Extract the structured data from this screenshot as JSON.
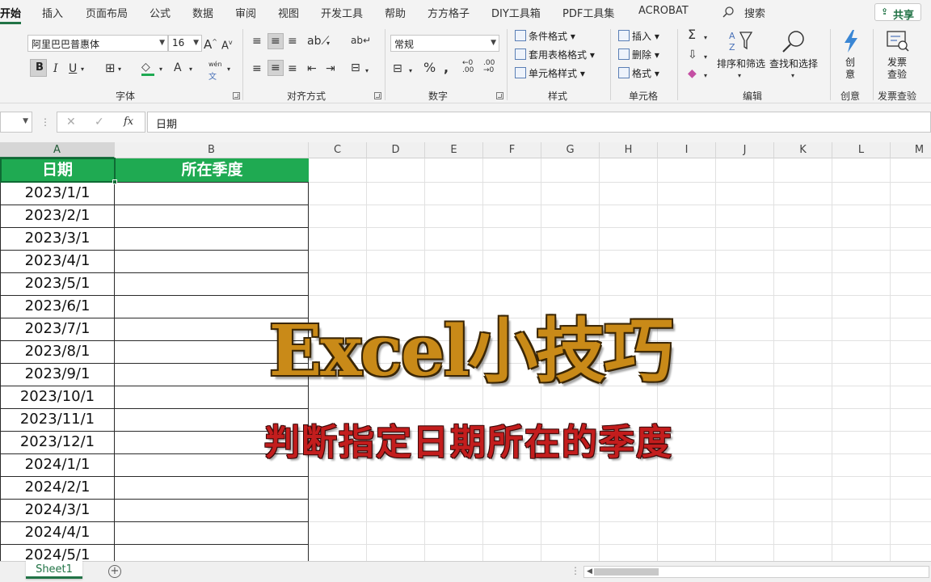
{
  "tabs": [
    {
      "label": "开始",
      "active": true
    },
    {
      "label": "插入"
    },
    {
      "label": "页面布局"
    },
    {
      "label": "公式"
    },
    {
      "label": "数据"
    },
    {
      "label": "审阅"
    },
    {
      "label": "视图"
    },
    {
      "label": "开发工具"
    },
    {
      "label": "帮助"
    },
    {
      "label": "方方格子"
    },
    {
      "label": "DIY工具箱"
    },
    {
      "label": "PDF工具集"
    },
    {
      "label": "ACROBAT"
    }
  ],
  "search_label": "搜索",
  "share_label": "共享",
  "ribbon": {
    "font_name": "阿里巴巴普惠体",
    "font_size": "16",
    "number_format": "常规",
    "font_group": "字体",
    "alignment_group": "对齐方式",
    "number_group": "数字",
    "styles_group": "样式",
    "cells_group": "单元格",
    "editing_group": "编辑",
    "creativity_group": "创意",
    "invoice_group": "发票查验",
    "conditional_format": "条件格式",
    "table_format": "套用表格格式",
    "cell_styles": "单元格样式",
    "insert": "插入",
    "delete": "删除",
    "format": "格式",
    "sort_filter": "排序和筛选",
    "find_select": "查找和选择",
    "create": "创意",
    "invoice_check": "发票查验",
    "phonetic": "wén",
    "phonetic_char": "文"
  },
  "formula_bar": {
    "value": "日期"
  },
  "columns": [
    "A",
    "B",
    "C",
    "D",
    "E",
    "F",
    "G",
    "H",
    "I",
    "J",
    "K",
    "L",
    "M"
  ],
  "headers": {
    "a": "日期",
    "b": "所在季度"
  },
  "dates": [
    "2023/1/1",
    "2023/2/1",
    "2023/3/1",
    "2023/4/1",
    "2023/5/1",
    "2023/6/1",
    "2023/7/1",
    "2023/8/1",
    "2023/9/1",
    "2023/10/1",
    "2023/11/1",
    "2023/12/1",
    "2024/1/1",
    "2024/2/1",
    "2024/3/1",
    "2024/4/1",
    "2024/5/1"
  ],
  "overlay": {
    "title": "Excel小技巧",
    "subtitle": "判断指定日期所在的季度"
  },
  "sheet_tab": "Sheet1",
  "colors": {
    "accent": "#217346",
    "header_fill": "#1faa52",
    "title": "#c98a18",
    "subtitle": "#c31d1d"
  }
}
